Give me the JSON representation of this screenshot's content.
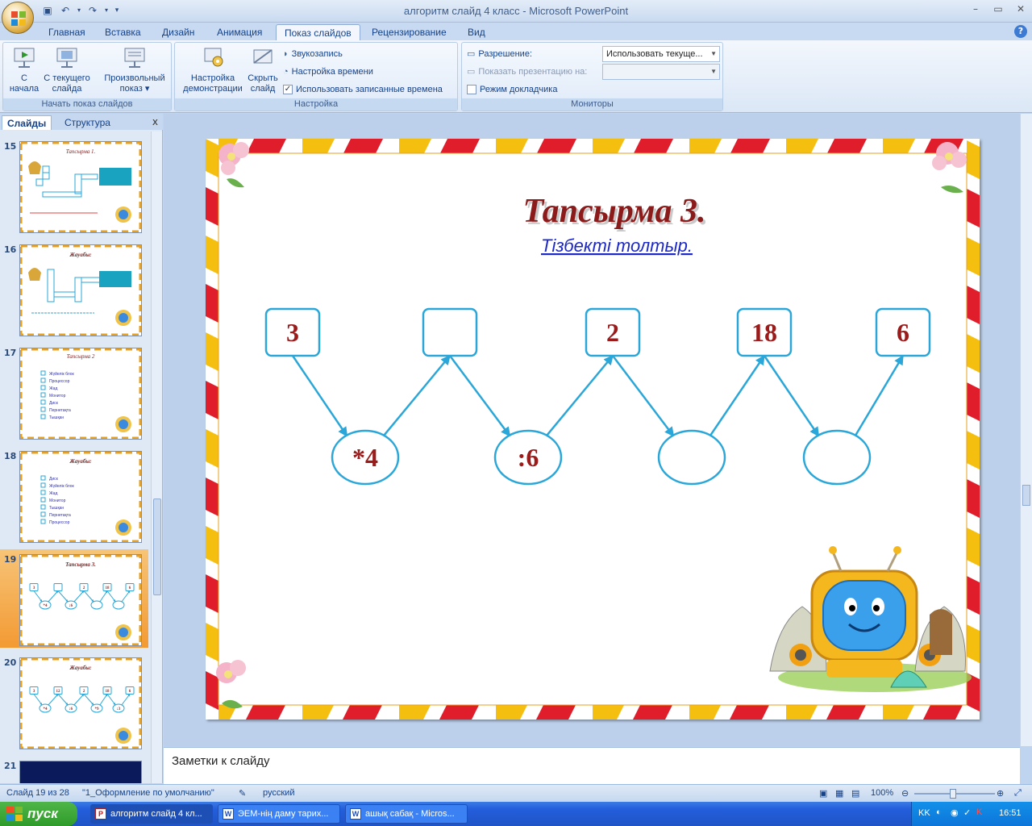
{
  "window": {
    "title": "алгоритм слайд 4 класс - Microsoft PowerPoint"
  },
  "ribbon": {
    "tabs": [
      "Главная",
      "Вставка",
      "Дизайн",
      "Анимация",
      "Показ слайдов",
      "Рецензирование",
      "Вид"
    ],
    "active_tab": "Показ слайдов",
    "groups": {
      "start": {
        "label": "Начать показ слайдов",
        "btn_from_start_1": "С",
        "btn_from_start_2": "начала",
        "btn_from_current_1": "С текущего",
        "btn_from_current_2": "слайда",
        "btn_custom_1": "Произвольный",
        "btn_custom_2": "показ ▾"
      },
      "setup": {
        "label": "Настройка",
        "btn_setup_1": "Настройка",
        "btn_setup_2": "демонстрации",
        "btn_hide_1": "Скрыть",
        "btn_hide_2": "слайд",
        "record_narration": "Звукозапись",
        "rehearse_timings": "Настройка времени",
        "use_timings": "Использовать записанные времена",
        "use_timings_checked": "✓"
      },
      "monitors": {
        "label": "Мониторы",
        "resolution_label": "Разрешение:",
        "resolution_value": "Использовать текуще...",
        "show_on_label": "Показать презентацию на:",
        "show_on_value": "",
        "presenter_view": "Режим докладчика"
      }
    }
  },
  "left_pane": {
    "tab_slides": "Слайды",
    "tab_outline": "Структура",
    "close": "x",
    "thumbnails": [
      {
        "num": "15",
        "title": "Тапсырма 1."
      },
      {
        "num": "16",
        "title": "Жауабы:"
      },
      {
        "num": "17",
        "title": "Тапсырма 2"
      },
      {
        "num": "18",
        "title": "Жауабы:"
      },
      {
        "num": "19",
        "title": "Тапсырма 3."
      },
      {
        "num": "20",
        "title": "Жауабы:"
      },
      {
        "num": "21",
        "title": ""
      }
    ],
    "thumb17_items": [
      "Жүйелік блок",
      "Процессор",
      "Жад",
      "Монитор",
      "Диск",
      "Пернетақта",
      "Тышқан"
    ],
    "thumb18_items": [
      "Диск",
      "Жүйелік блок",
      "Жад",
      "Монитор",
      "Тышқан",
      "Пернетақта",
      "Процессор"
    ],
    "thumb19_top": [
      "3",
      "",
      "2",
      "18",
      "6"
    ],
    "thumb19_bottom": [
      "*4",
      ":6",
      "",
      ""
    ],
    "thumb20_top": [
      "3",
      "12",
      "2",
      "18",
      "6"
    ],
    "thumb20_bottom": [
      "*4",
      ":6",
      "*9",
      ":3"
    ]
  },
  "slide": {
    "title": "Тапсырма 3.",
    "subtitle": "Тізбекті толтыр.",
    "top_boxes": [
      "3",
      "",
      "2",
      "18",
      "6"
    ],
    "bottom_ovals": [
      "*4",
      ":6",
      "",
      ""
    ]
  },
  "notes": {
    "placeholder": "Заметки к слайду"
  },
  "status": {
    "slide_info": "Слайд 19 из 28",
    "theme": "\"1_Оформление по умолчанию\"",
    "language": "русский",
    "zoom": "100%"
  },
  "taskbar": {
    "start": "пуск",
    "items": [
      "алгоритм слайд 4 кл...",
      "ЭЕМ-нің даму тарих...",
      "ашық сабақ - Micros..."
    ],
    "lang": "KK",
    "time": "16:51"
  },
  "colors": {
    "slide_title": "#8b1a1a",
    "subtitle": "#1c28c8",
    "diagram_stroke": "#2aa7d8",
    "number_color": "#9b1b1b"
  }
}
